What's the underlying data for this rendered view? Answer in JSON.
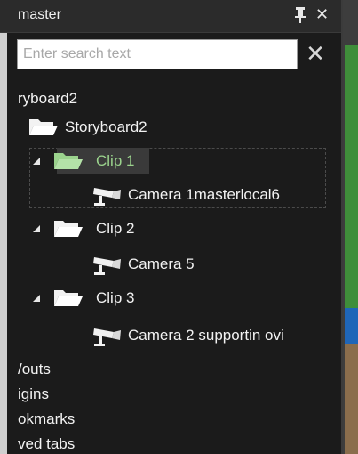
{
  "panel": {
    "title": "master",
    "search": {
      "placeholder": "Enter search text"
    },
    "tree": {
      "root_partial": "ryboard2",
      "storyboard": "Storyboard2",
      "clips": [
        {
          "label": "Clip 1",
          "camera": "Camera 1masterlocal6",
          "selected": true
        },
        {
          "label": "Clip 2",
          "camera": "Camera 5",
          "selected": false
        },
        {
          "label": "Clip 3",
          "camera": "Camera 2 supportin ovi",
          "selected": false
        }
      ],
      "bottom_partial_items": [
        "/outs",
        "igins",
        "okmarks",
        "ved tabs"
      ]
    }
  },
  "colors": {
    "panel_bg": "#1b1b1b",
    "titlebar_bg": "#2b2b2b",
    "selected_text": "#9bd38d",
    "text": "#f2f2f2",
    "accent_green": "#3f8e3a",
    "accent_blue": "#1f66b8"
  },
  "icons": {
    "pin": "pin-icon",
    "close": "close-icon",
    "clear": "clear-search-icon",
    "folder": "folder-icon",
    "camera": "camera-icon",
    "expander": "expand-arrow-icon"
  }
}
